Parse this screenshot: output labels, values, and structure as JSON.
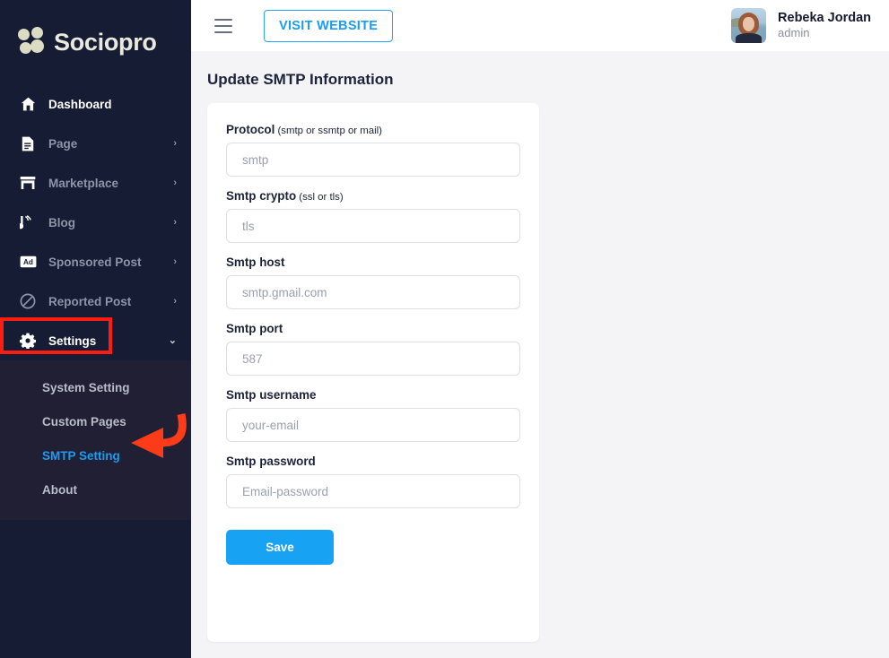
{
  "brand": {
    "name": "Sociopro",
    "logo_icon": "clover-dots-logo"
  },
  "sidebar": {
    "items": [
      {
        "label": "Dashboard",
        "icon": "home-icon",
        "active": true,
        "chevron": ""
      },
      {
        "label": "Page",
        "icon": "document-icon",
        "active": false,
        "chevron": "›"
      },
      {
        "label": "Marketplace",
        "icon": "store-icon",
        "active": false,
        "chevron": "›"
      },
      {
        "label": "Blog",
        "icon": "blog-rss-icon",
        "active": false,
        "chevron": "›"
      },
      {
        "label": "Sponsored Post",
        "icon": "ad-icon",
        "active": false,
        "chevron": "›"
      },
      {
        "label": "Reported Post",
        "icon": "block-icon",
        "active": false,
        "chevron": "›"
      },
      {
        "label": "Settings",
        "icon": "gear-icon",
        "active": true,
        "chevron": "⌄"
      }
    ],
    "submenu": [
      {
        "label": "System Setting",
        "active": false
      },
      {
        "label": "Custom Pages",
        "active": false
      },
      {
        "label": "SMTP Setting",
        "active": true
      },
      {
        "label": "About",
        "active": false
      }
    ]
  },
  "topbar": {
    "menu_icon": "hamburger-icon",
    "visit_website_label": "VISIT WEBSITE",
    "user": {
      "name": "Rebeka Jordan",
      "role": "admin",
      "avatar_icon": "user-avatar-photo"
    }
  },
  "main": {
    "title": "Update SMTP Information",
    "fields": [
      {
        "label": "Protocol",
        "hint": " (smtp or ssmtp or mail)",
        "placeholder": "smtp",
        "value": "",
        "type": "text"
      },
      {
        "label": "Smtp crypto",
        "hint": " (ssl or tls)",
        "placeholder": "tls",
        "value": "",
        "type": "text"
      },
      {
        "label": "Smtp host",
        "hint": "",
        "placeholder": "smtp.gmail.com",
        "value": "",
        "type": "text"
      },
      {
        "label": "Smtp port",
        "hint": "",
        "placeholder": "587",
        "value": "",
        "type": "text"
      },
      {
        "label": "Smtp username",
        "hint": "",
        "placeholder": "your-email",
        "value": "",
        "type": "text"
      },
      {
        "label": "Smtp password",
        "hint": "",
        "placeholder": "Email-password",
        "value": "",
        "type": "text"
      }
    ],
    "save_label": "Save"
  },
  "annotations": {
    "highlight_color": "#fc1c10",
    "highlight_target": "Settings",
    "arrow_target": "SMTP Setting"
  },
  "colors": {
    "sidebar_bg": "#161c33",
    "submenu_bg": "#211f33",
    "accent": "#17a2f3",
    "link": "#1b9cf0",
    "content_bg": "#f4f4f7",
    "annotation_red": "#fc1c10"
  }
}
